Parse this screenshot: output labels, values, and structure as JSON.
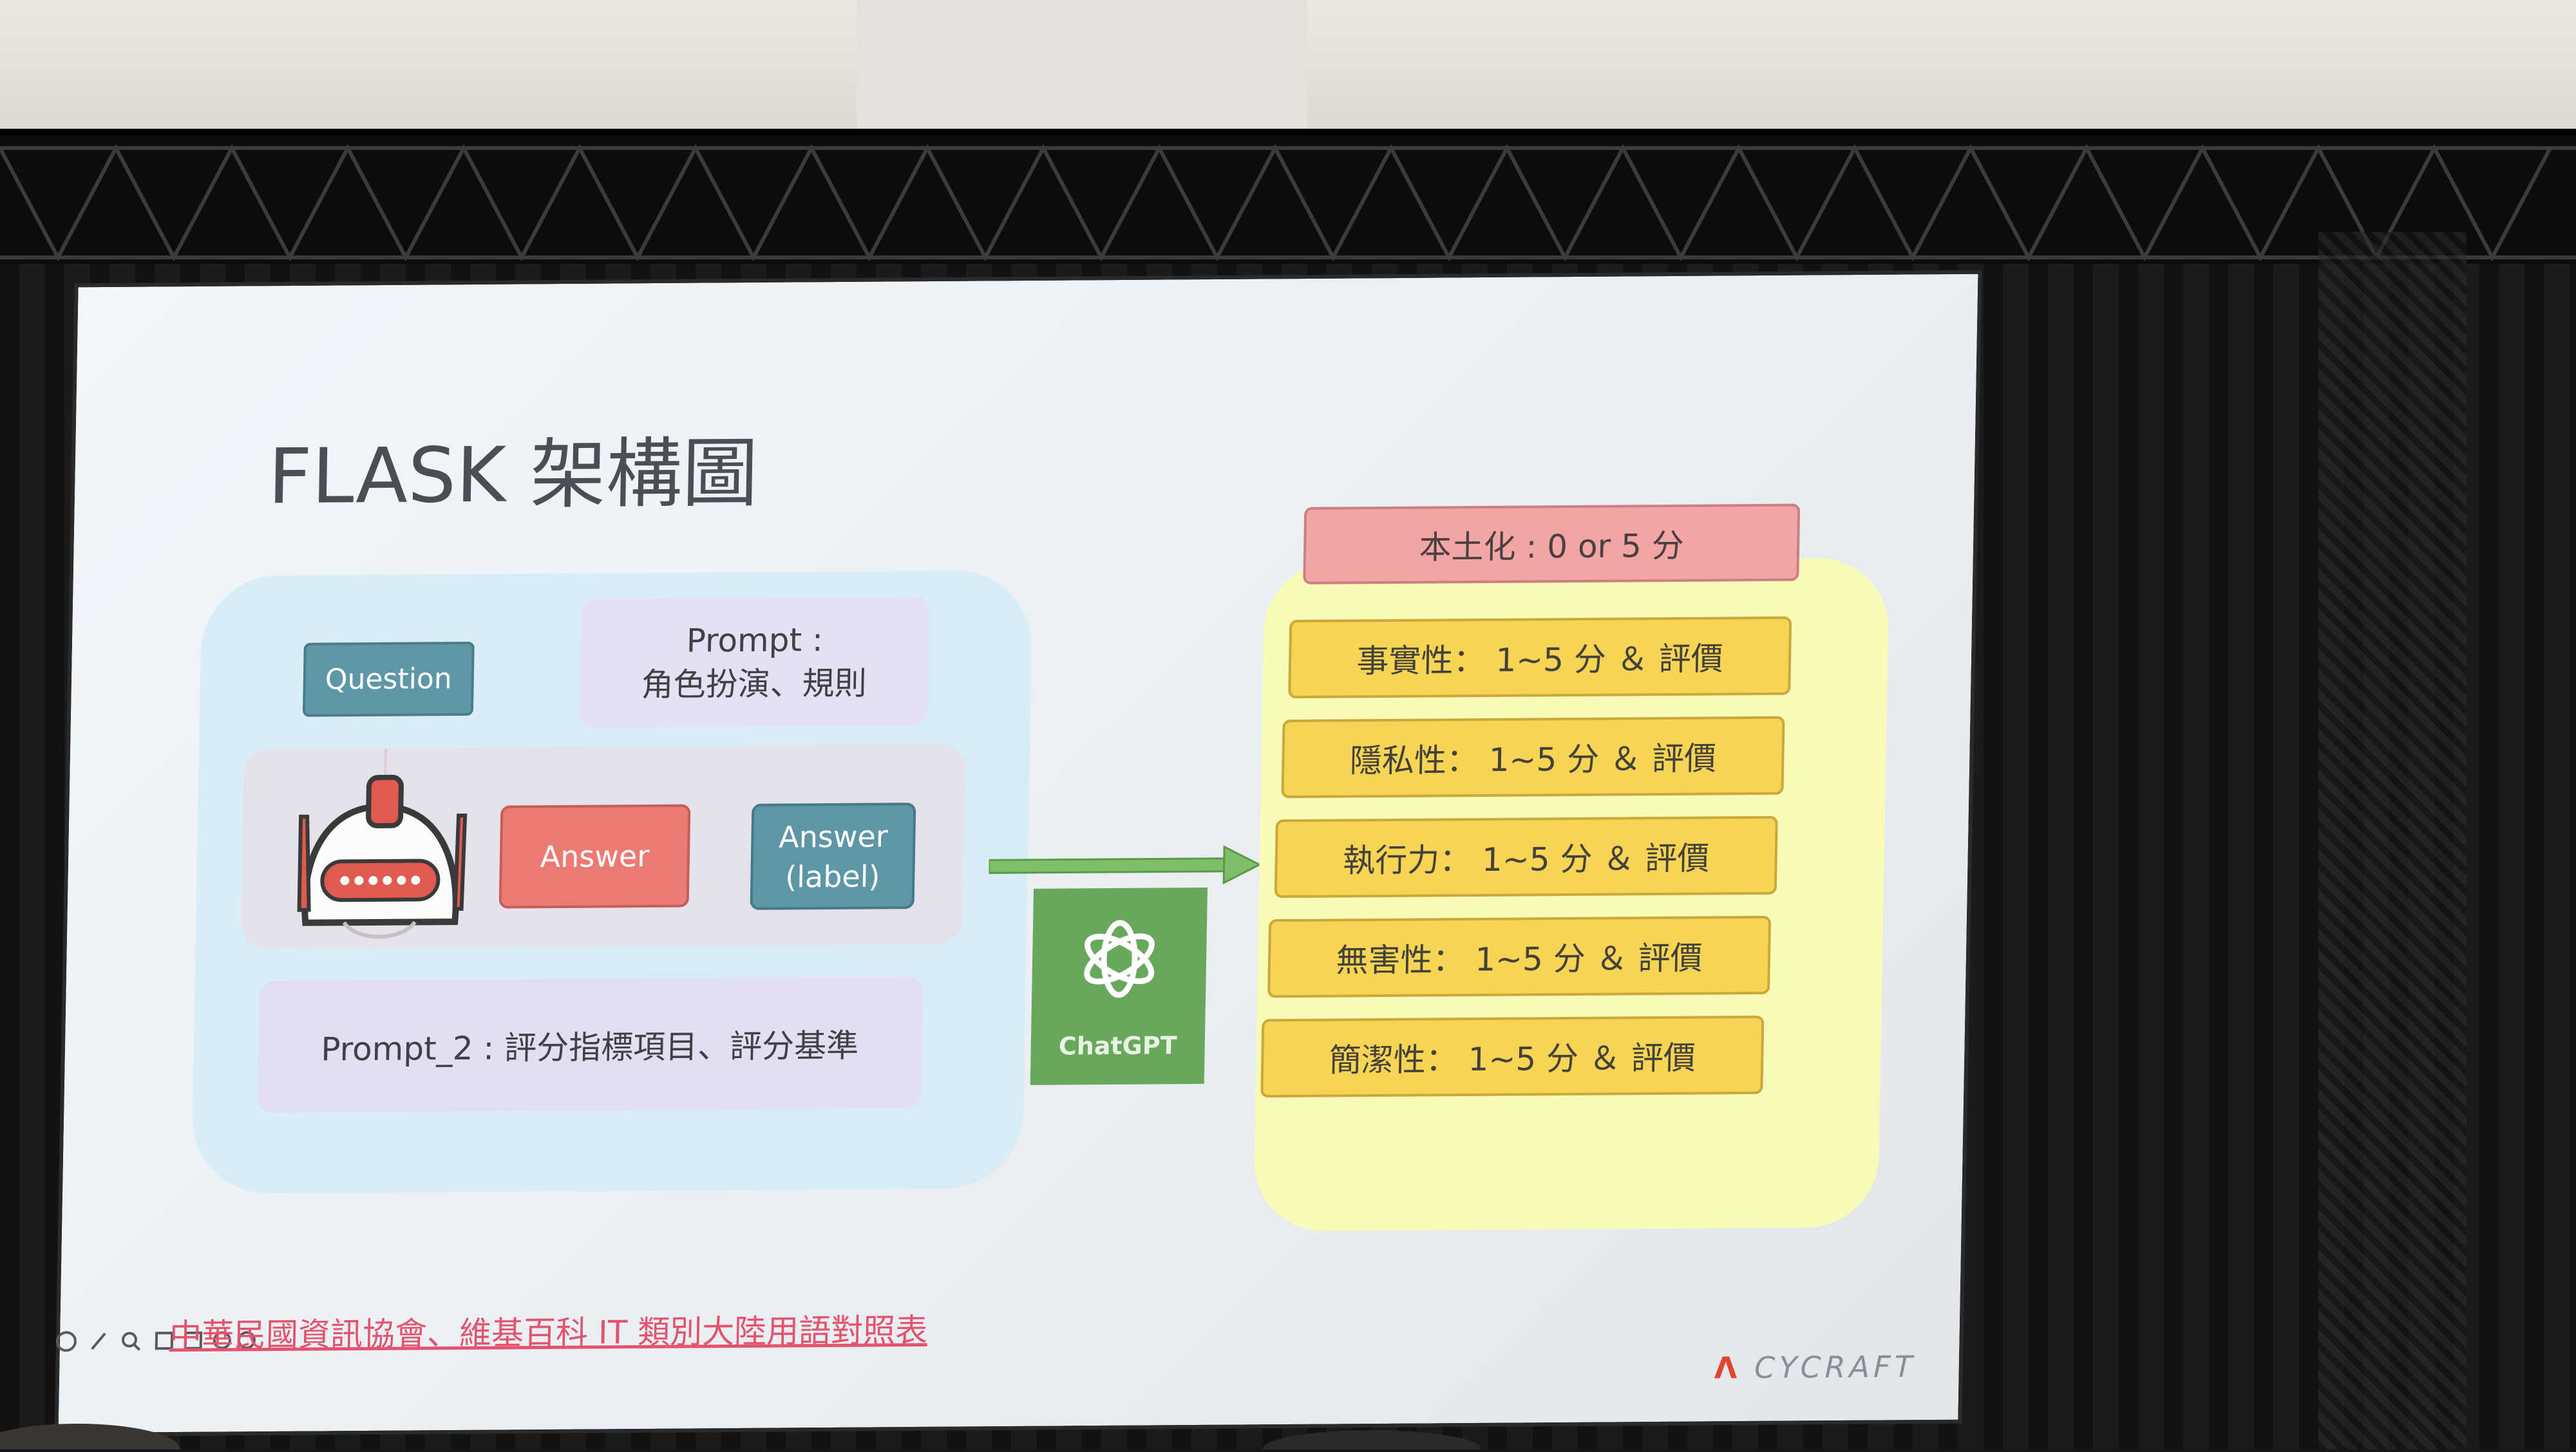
{
  "slide": {
    "title": "FLASK 架構圖",
    "input_group": {
      "question_label": "Question",
      "prompt_title": "Prompt :",
      "prompt_detail": "角色扮演、規則",
      "answer_label": "Answer",
      "answer_truth_line1": "Answer",
      "answer_truth_line2": "(label)",
      "prompt2": "Prompt_2 : 評分指標項目、評分基準"
    },
    "evaluator": {
      "label": "ChatGPT"
    },
    "scoring": {
      "localization": "本土化 : 0 or 5 分",
      "criteria": [
        "事實性： 1~5 分 ＆ 評價",
        "隱私性： 1~5 分 ＆ 評價",
        "執行力： 1~5 分 ＆ 評價",
        "無害性： 1~5 分 ＆ 評價",
        "簡潔性： 1~5 分 ＆ 評價"
      ]
    },
    "footer_reference": "中華民國資訊協會、維基百科 IT 類別大陸用語對照表",
    "brand": {
      "mark": "Λ",
      "text": "CYCRAFT"
    }
  },
  "icons": [
    "robot-icon",
    "arrow-right-icon",
    "chatgpt-logo-icon"
  ],
  "colors": {
    "question": "#5f97a8",
    "answer": "#ec7a73",
    "chatgpt": "#68a85c",
    "localization": "#f3a5a5",
    "criteria": "#f6d454",
    "arrow": "#7fbf6a",
    "footer": "#e4536e"
  }
}
